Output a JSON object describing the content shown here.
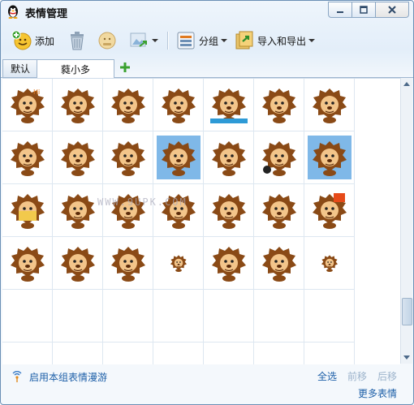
{
  "window": {
    "title": "表情管理"
  },
  "toolbar": {
    "add_label": "添加",
    "group_label": "分组",
    "import_export_label": "导入和导出"
  },
  "tabs": [
    {
      "label": "默认"
    },
    {
      "label": "蕤小多"
    }
  ],
  "grid": {
    "rows": [
      [
        "hi",
        "wink",
        "smile",
        "bug",
        "ok",
        "mirror",
        "sly"
      ],
      [
        "guitar",
        "frown",
        "tsk",
        "moon",
        "cry",
        "bomb",
        "diver"
      ],
      [
        "sign",
        "cry2",
        "shy",
        "point",
        "shock",
        "writing",
        "cheer"
      ],
      [
        "frown2",
        "tired",
        "dizzy",
        "tiny",
        "fall",
        "walk",
        "tiny2"
      ]
    ],
    "empty_rows": 2,
    "columns": 7
  },
  "watermark": "WWW.9UPK.COM",
  "bottom": {
    "roam_label": "启用本组表情漫游",
    "select_all": "全选",
    "move_forward": "前移",
    "move_back": "后移",
    "more": "更多表情"
  },
  "scrollbar": {
    "position": 0.88,
    "visible_fraction": 0.1
  }
}
